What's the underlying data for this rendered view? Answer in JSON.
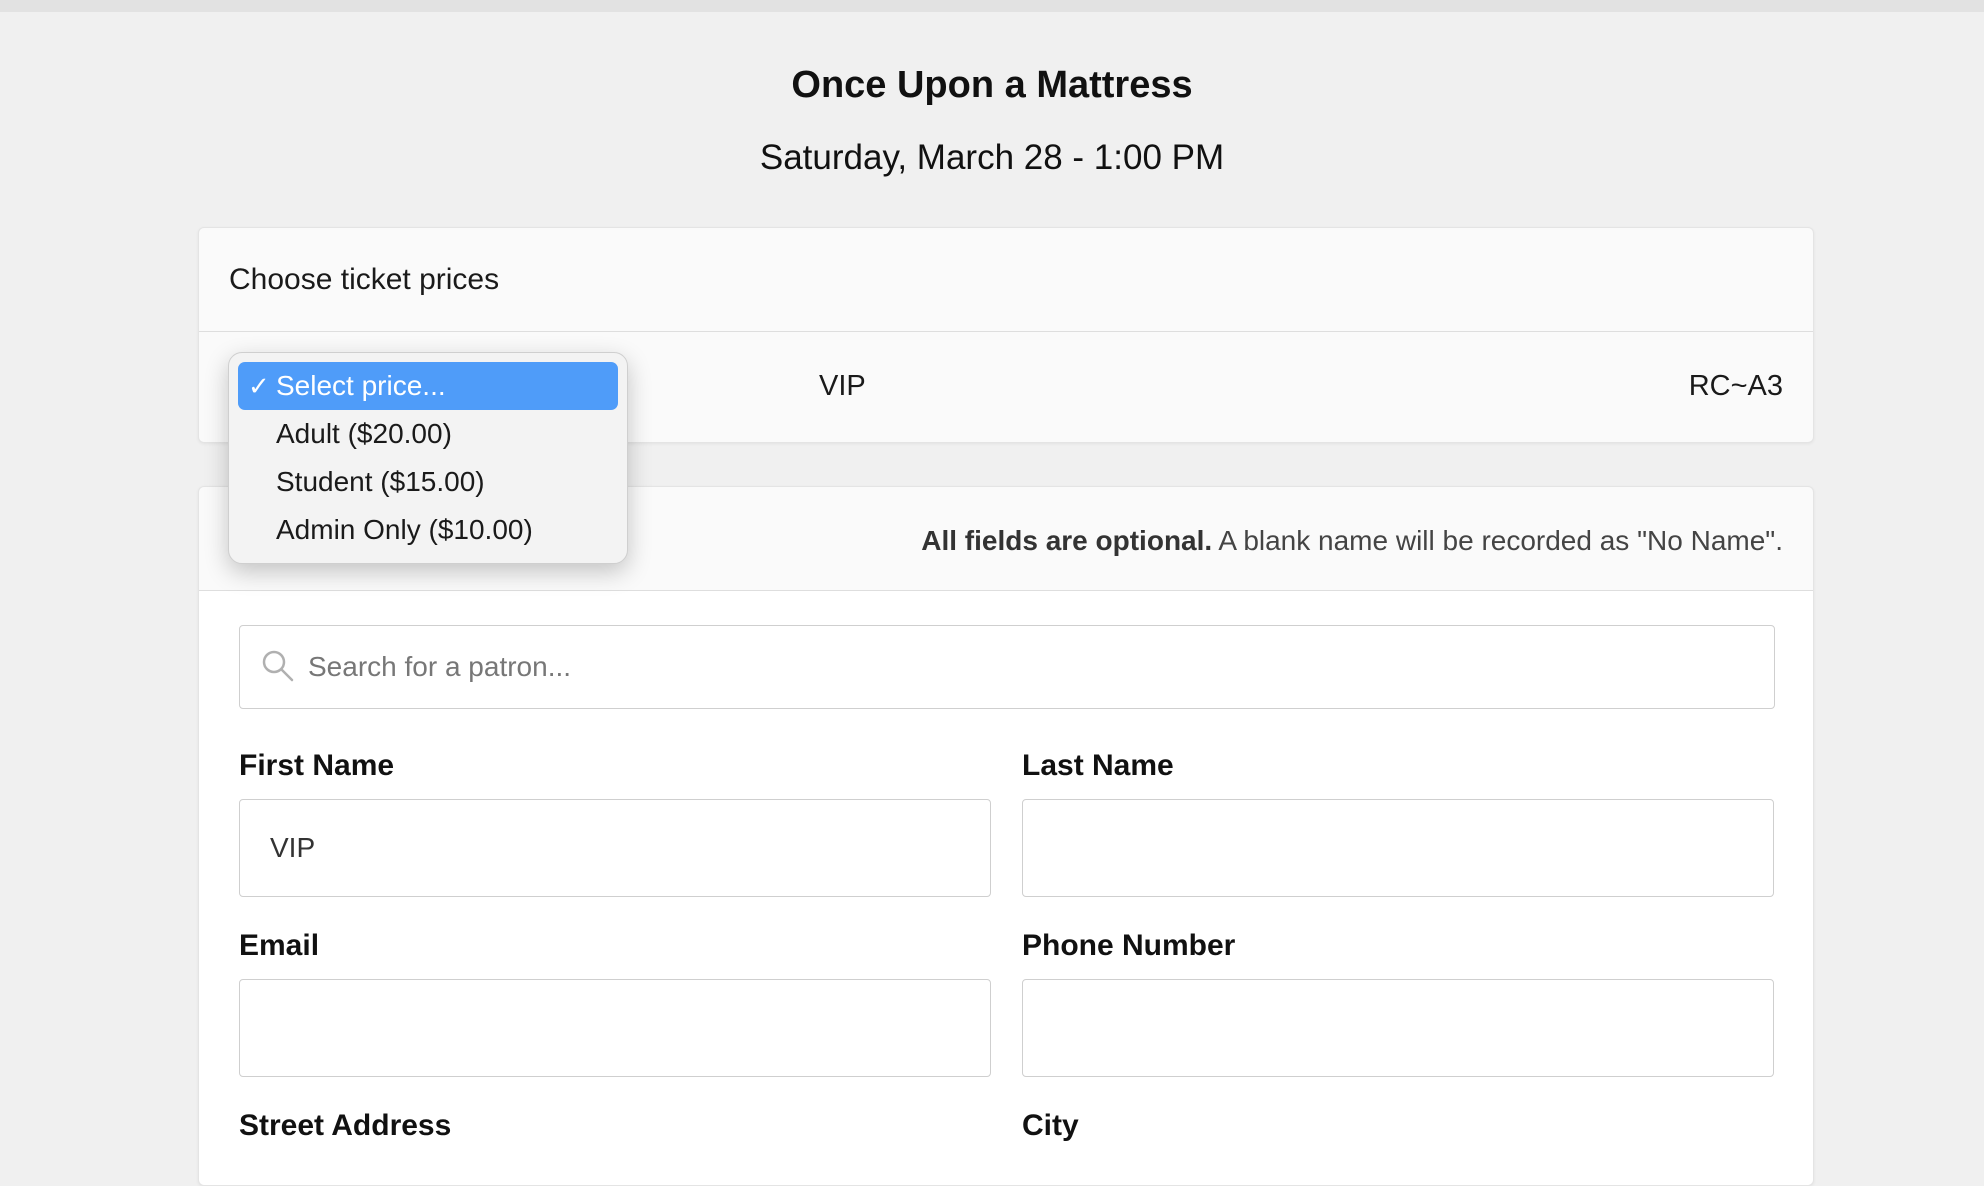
{
  "header": {
    "title": "Once Upon a Mattress",
    "date": "Saturday, March 28 - 1:00 PM"
  },
  "prices": {
    "heading": "Choose ticket prices",
    "row": {
      "type": "VIP",
      "seat": "RC~A3"
    },
    "dropdown": {
      "options": [
        {
          "label": "Select price...",
          "selected": true
        },
        {
          "label": "Adult ($20.00)",
          "selected": false
        },
        {
          "label": "Student ($15.00)",
          "selected": false
        },
        {
          "label": "Admin Only ($10.00)",
          "selected": false
        }
      ],
      "check_glyph": "✓"
    }
  },
  "patron": {
    "note_bold": "All fields are optional.",
    "note_rest": " A blank name will be recorded as \"No Name\".",
    "search_placeholder": "Search for a patron...",
    "first_name_label": "First Name",
    "first_name_value": "VIP",
    "last_name_label": "Last Name",
    "last_name_value": "",
    "email_label": "Email",
    "email_value": "",
    "phone_label": "Phone Number",
    "phone_value": "",
    "street_label": "Street Address",
    "city_label": "City"
  },
  "colors": {
    "accent": "#4f9cf9",
    "background": "#f0f0f0"
  }
}
